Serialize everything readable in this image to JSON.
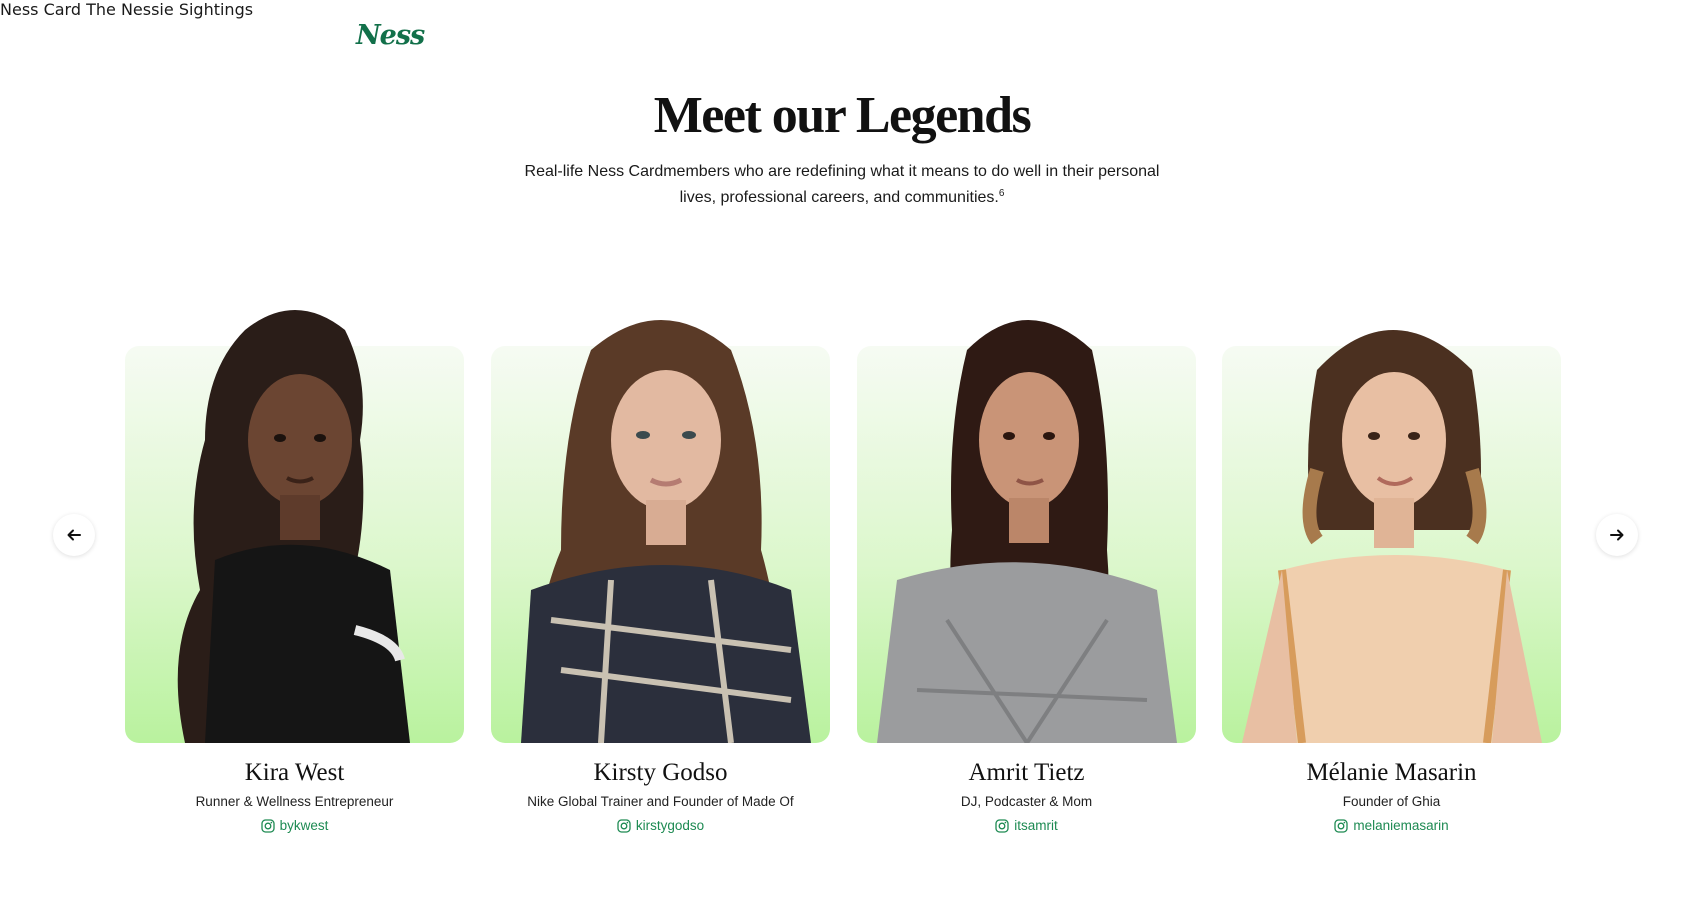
{
  "brand": {
    "logo_text": "Ness",
    "color": "#12704a"
  },
  "nav": {
    "items": [
      "Ness Card",
      "The Nessie",
      "Sightings"
    ]
  },
  "hero": {
    "title": "Meet our Legends",
    "subtitle": "Real-life Ness Cardmembers who are redefining what it means to do well in their personal lives, professional careers, and communities.",
    "footnote": "6"
  },
  "carousel": {
    "prev_icon": "arrow-left-icon",
    "next_icon": "arrow-right-icon",
    "cards": [
      {
        "name": "Kira West",
        "role": "Runner & Wellness Entrepreneur",
        "handle": "bykwest"
      },
      {
        "name": "Kirsty Godso",
        "role": "Nike Global Trainer and Founder of Made Of",
        "handle": "kirstygodso"
      },
      {
        "name": "Amrit Tietz",
        "role": "DJ, Podcaster & Mom",
        "handle": "itsamrit"
      },
      {
        "name": "Mélanie Masarin",
        "role": "Founder of Ghia",
        "handle": "melaniemasarin"
      }
    ]
  },
  "colors": {
    "accent_green": "#1d8a52",
    "card_gradient_top": "#f6fbf3",
    "card_gradient_bottom": "#b9f29e"
  }
}
